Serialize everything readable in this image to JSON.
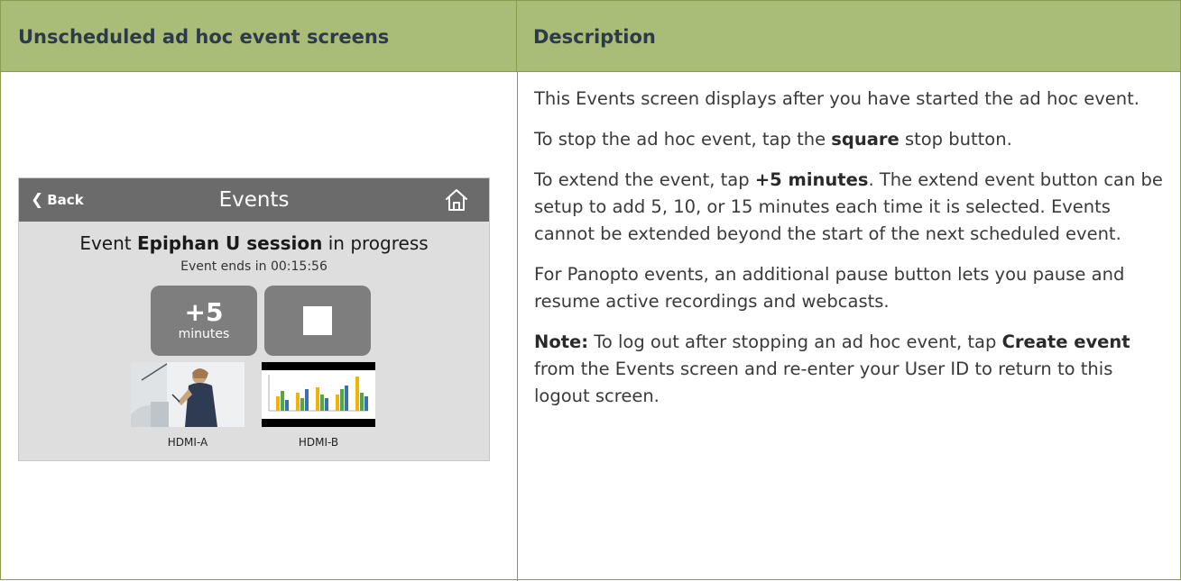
{
  "table": {
    "header_left": "Unscheduled ad hoc event screens",
    "header_right": "Description"
  },
  "device": {
    "back_label": "Back",
    "title": "Events",
    "event_prefix": "Event ",
    "event_name": "Epiphan U session",
    "event_suffix": " in progress",
    "ends_text": "Event ends in 00:15:56",
    "extend_value": "+5",
    "extend_unit": "minutes",
    "sources": [
      "HDMI-A",
      "HDMI-B"
    ]
  },
  "description": {
    "p1": "This Events screen displays after you have started the ad hoc event.",
    "p2_pre": "To stop the ad hoc event, tap the ",
    "p2_bold": "square",
    "p2_post": " stop button.",
    "p3_pre": "To extend the event, tap ",
    "p3_bold": "+5 minutes",
    "p3_post": ". The extend event button can be setup to add 5, 10, or 15 minutes each time it is selected. Events cannot be extended beyond the start of the next scheduled event.",
    "p4": "For Panopto events, an additional pause button lets you pause and resume active recordings and webcasts.",
    "p5_bold1": "Note:",
    "p5_mid1": " To log out after stopping an ad hoc event, tap ",
    "p5_bold2": "Create event",
    "p5_post": " from the Events screen and re-enter your User ID to return to this logout screen."
  },
  "colors": {
    "header_bg": "#a9bd78",
    "border": "#8a9a4e",
    "device_header": "#6b6b6b",
    "device_button": "#7e7e7e"
  },
  "icons": [
    "chevron-left-icon",
    "home-icon",
    "stop-square-icon"
  ]
}
